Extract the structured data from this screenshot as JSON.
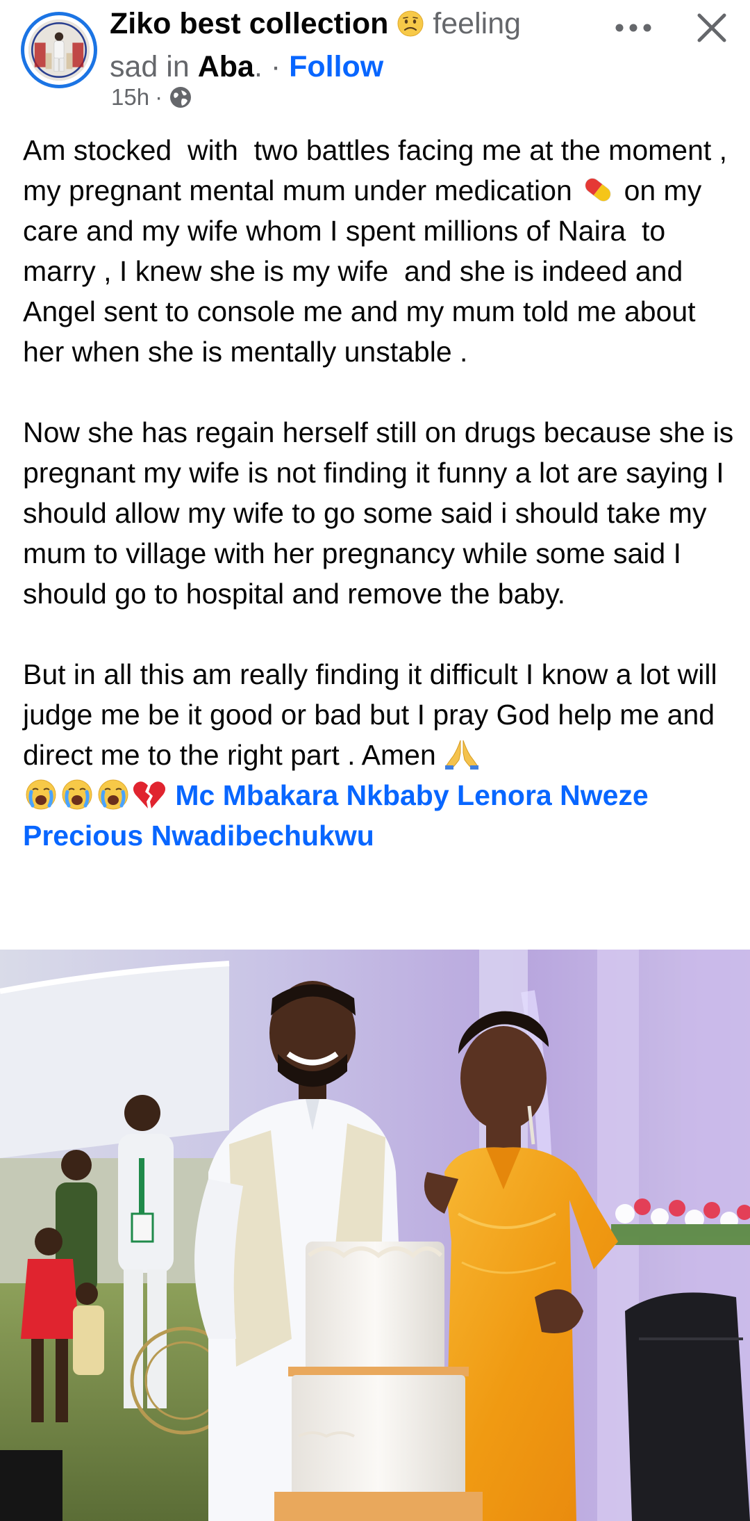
{
  "header": {
    "page_name": "Ziko best collection",
    "feeling_prefix": "feeling",
    "feeling_text": "sad in",
    "location": "Aba",
    "location_suffix": ".",
    "separator": " · ",
    "follow_label": "Follow",
    "timestamp": "15h",
    "meta_separator": "·",
    "privacy_icon": "globe-icon",
    "feeling_icon": "sad-face-emoji",
    "more_icon": "more-dots-icon",
    "close_icon": "close-icon"
  },
  "post": {
    "paragraph_1_a": "Am stocked  with  two battles facing me at the moment , my pregnant mental mum under medication ",
    "paragraph_1_b": " on my care and my wife whom I spent millions of Naira  to marry , I knew she is my wife  and she is indeed and Angel sent to console me and my mum told me about her when she is mentally unstable .",
    "paragraph_2": "Now she has regain herself still on drugs because she is pregnant my wife is not finding it funny a lot are saying I should allow my wife to go some said i should take my mum to village with her pregnancy while some said I should go to hospital and remove the baby.",
    "paragraph_3": "But in all this am really finding it difficult I know a lot will judge me be it good or bad but I pray God help me and direct me to the right part . Amen ",
    "tags": [
      "Mc Mbakara",
      "Nkbaby Lenora Nweze",
      "Precious Nwadibechukwu"
    ],
    "emojis": [
      "pill-emoji",
      "praying-hands-emoji",
      "crying-face-emoji",
      "crying-face-emoji",
      "crying-face-emoji",
      "broken-heart-emoji"
    ]
  },
  "photo": {
    "subject": "wedding-photo",
    "accent_colors": {
      "dress": "#f0a21a",
      "backdrop": "#b7a9dc",
      "cake": "#f5f2ee"
    }
  },
  "colors": {
    "link_blue": "#0866ff",
    "avatar_ring": "#1b74e4",
    "secondary_text": "#65676b",
    "primary_text": "#050505"
  }
}
